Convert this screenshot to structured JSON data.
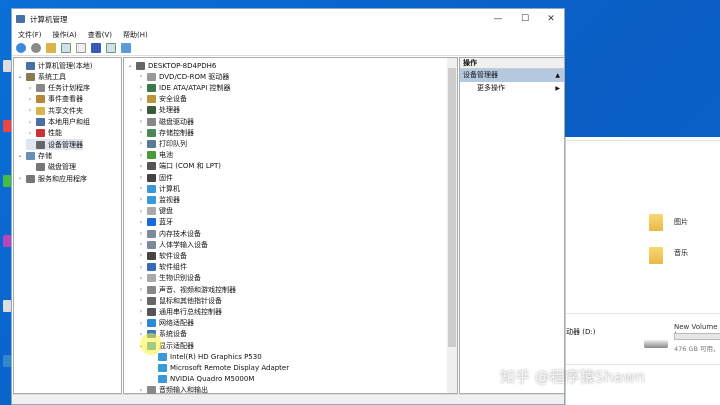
{
  "window": {
    "title": "计算机管理",
    "minimize": "—",
    "maximize": "☐",
    "close": "✕"
  },
  "menu": [
    "文件(F)",
    "操作(A)",
    "查看(V)",
    "帮助(H)"
  ],
  "toolbar_icons": [
    "back-icon",
    "forward-icon",
    "up-icon",
    "show-hide-tree-icon",
    "export-icon",
    "help-icon",
    "properties-icon",
    "monitor-icon"
  ],
  "tree": [
    {
      "label": "计算机管理(本地)",
      "level": 0,
      "arrow": "",
      "color": "#4a6fa5"
    },
    {
      "label": "系统工具",
      "level": 0,
      "arrow": "⌄",
      "color": "#8a7a50"
    },
    {
      "label": "任务计划程序",
      "level": 1,
      "arrow": "›",
      "color": "#888"
    },
    {
      "label": "事件查看器",
      "level": 1,
      "arrow": "›",
      "color": "#b8863b"
    },
    {
      "label": "共享文件夹",
      "level": 1,
      "arrow": "›",
      "color": "#d9b44a"
    },
    {
      "label": "本地用户和组",
      "level": 1,
      "arrow": "›",
      "color": "#4a6fa5"
    },
    {
      "label": "性能",
      "level": 1,
      "arrow": "›",
      "color": "#c33"
    },
    {
      "label": "设备管理器",
      "level": 1,
      "arrow": "",
      "color": "#666",
      "selected": true
    },
    {
      "label": "存储",
      "level": 0,
      "arrow": "⌄",
      "color": "#6a8fb5"
    },
    {
      "label": "磁盘管理",
      "level": 1,
      "arrow": "",
      "color": "#777"
    },
    {
      "label": "服务和应用程序",
      "level": 0,
      "arrow": "›",
      "color": "#777"
    }
  ],
  "devices": [
    {
      "label": "DESKTOP-8D4PDH6",
      "level": 0,
      "arrow": "⌄",
      "color": "#666"
    },
    {
      "label": "DVD/CD-ROM 驱动器",
      "level": 1,
      "arrow": "›",
      "color": "#999"
    },
    {
      "label": "IDE ATA/ATAPI 控制器",
      "level": 1,
      "arrow": "›",
      "color": "#3a7a4a"
    },
    {
      "label": "安全设备",
      "level": 1,
      "arrow": "›",
      "color": "#b8963b"
    },
    {
      "label": "处理器",
      "level": 1,
      "arrow": "›",
      "color": "#3a5a3a"
    },
    {
      "label": "磁盘驱动器",
      "level": 1,
      "arrow": "›",
      "color": "#888"
    },
    {
      "label": "存储控制器",
      "level": 1,
      "arrow": "›",
      "color": "#4a8a5a"
    },
    {
      "label": "打印队列",
      "level": 1,
      "arrow": "›",
      "color": "#5a7a9a"
    },
    {
      "label": "电池",
      "level": 1,
      "arrow": "›",
      "color": "#4a9a3a"
    },
    {
      "label": "端口 (COM 和 LPT)",
      "level": 1,
      "arrow": "›",
      "color": "#555"
    },
    {
      "label": "固件",
      "level": 1,
      "arrow": "›",
      "color": "#444"
    },
    {
      "label": "计算机",
      "level": 1,
      "arrow": "›",
      "color": "#3a9ad9"
    },
    {
      "label": "监视器",
      "level": 1,
      "arrow": "›",
      "color": "#3a9ad9"
    },
    {
      "label": "键盘",
      "level": 1,
      "arrow": "›",
      "color": "#aaa"
    },
    {
      "label": "蓝牙",
      "level": 1,
      "arrow": "›",
      "color": "#1a6ad9"
    },
    {
      "label": "内存技术设备",
      "level": 1,
      "arrow": "›",
      "color": "#7a8a9a"
    },
    {
      "label": "人体学输入设备",
      "level": 1,
      "arrow": "›",
      "color": "#7a8a9a"
    },
    {
      "label": "软件设备",
      "level": 1,
      "arrow": "›",
      "color": "#444"
    },
    {
      "label": "软件组件",
      "level": 1,
      "arrow": "›",
      "color": "#3a6ab5"
    },
    {
      "label": "生物识别设备",
      "level": 1,
      "arrow": "›",
      "color": "#aaa"
    },
    {
      "label": "声音、视频和游戏控制器",
      "level": 1,
      "arrow": "›",
      "color": "#888"
    },
    {
      "label": "鼠标和其他指针设备",
      "level": 1,
      "arrow": "›",
      "color": "#666"
    },
    {
      "label": "通用串行总线控制器",
      "level": 1,
      "arrow": "›",
      "color": "#555"
    },
    {
      "label": "网络适配器",
      "level": 1,
      "arrow": "›",
      "color": "#2a8ad9"
    },
    {
      "label": "系统设备",
      "level": 1,
      "arrow": "›",
      "color": "#3a7ac5"
    },
    {
      "label": "显示适配器",
      "level": 1,
      "arrow": "⌄",
      "color": "#3a9ad9"
    },
    {
      "label": "Intel(R) HD Graphics P530",
      "level": 2,
      "arrow": "",
      "color": "#3a9ad9"
    },
    {
      "label": "Microsoft Remote Display Adapter",
      "level": 2,
      "arrow": "",
      "color": "#3a9ad9"
    },
    {
      "label": "NVIDIA Quadro M5000M",
      "level": 2,
      "arrow": "",
      "color": "#3a9ad9"
    },
    {
      "label": "音频输入和输出",
      "level": 1,
      "arrow": "›",
      "color": "#888"
    }
  ],
  "actions": {
    "header": "操作",
    "section": "设备管理器",
    "section_arrow": "▲",
    "more": "更多操作",
    "more_arrow": "▶"
  },
  "explorer": {
    "pictures": "图片",
    "music": "音乐",
    "drive_partial": "动器 (D:)",
    "volume_name": "New Volume (",
    "volume_free": "476 GB 可用，"
  },
  "watermark": "知乎 @程序猿Shawn"
}
